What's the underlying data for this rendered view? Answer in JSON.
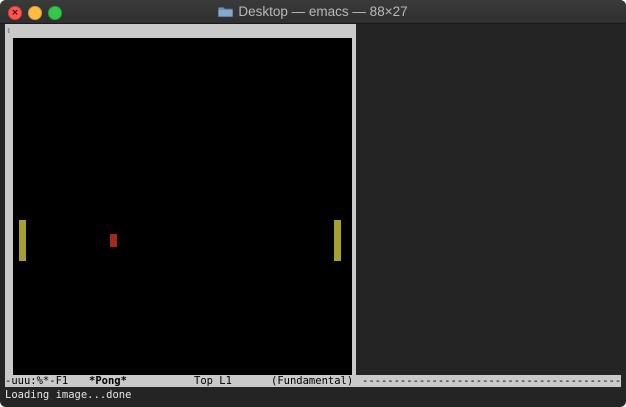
{
  "window": {
    "title": "Desktop — emacs — 88×27",
    "title_icon": "folder-icon",
    "controls": {
      "close_glyph": "×",
      "close_color": "#fc5753",
      "minimize_color": "#fdbc40",
      "zoom_color": "#34c84a"
    }
  },
  "buffer": {
    "background": "#000000",
    "frame_color": "#c9c9c9",
    "corner_mark": "↕"
  },
  "pong": {
    "left_paddle_color": "#a6a031",
    "right_paddle_color": "#a6a031",
    "ball_color": "#a22a18"
  },
  "modeline": {
    "status": "-uuu:%*-F1",
    "buffer_name": "*Pong*",
    "position": "Top L1",
    "mode": "(Fundamental)",
    "fill": "-------------------------------------------"
  },
  "echo_area": {
    "message": "Loading image...done"
  }
}
